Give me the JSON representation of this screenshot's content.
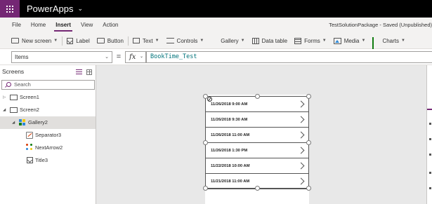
{
  "app": {
    "title": "PowerApps"
  },
  "menu": {
    "items": [
      {
        "label": "File"
      },
      {
        "label": "Home"
      },
      {
        "label": "Insert"
      },
      {
        "label": "View"
      },
      {
        "label": "Action"
      }
    ],
    "active_item": "Insert",
    "package_status": "TestSolutionPackage - Saved (Unpublished)"
  },
  "ribbon": {
    "new_screen": "New screen",
    "label": "Label",
    "button": "Button",
    "text": "Text",
    "controls": "Controls",
    "gallery": "Gallery",
    "data_table": "Data table",
    "forms": "Forms",
    "media": "Media",
    "charts": "Charts"
  },
  "formula_bar": {
    "property": "Items",
    "equals": "=",
    "fx": "fx",
    "formula": "BookTime_Test"
  },
  "left_panel": {
    "title": "Screens",
    "search_placeholder": "Search",
    "tree": {
      "screen1": "Screen1",
      "screen2": "Screen2",
      "gallery2": "Gallery2",
      "separator3": "Separator3",
      "nextarrow2": "NextArrow2",
      "title3": "Title3"
    }
  },
  "gallery": {
    "items": [
      {
        "text": "11/26/2018 9:00 AM"
      },
      {
        "text": "11/26/2018 9:30 AM"
      },
      {
        "text": "11/26/2018 11:00 AM"
      },
      {
        "text": "11/26/2018 1:30 PM"
      },
      {
        "text": "11/22/2018 10:00 AM"
      },
      {
        "text": "11/21/2018 11:00 AM"
      }
    ]
  },
  "colors": {
    "accent": "#742774",
    "title_bar": "#000000",
    "canvas": "#e8e8e8",
    "selected_row": "#e1dfdd"
  }
}
